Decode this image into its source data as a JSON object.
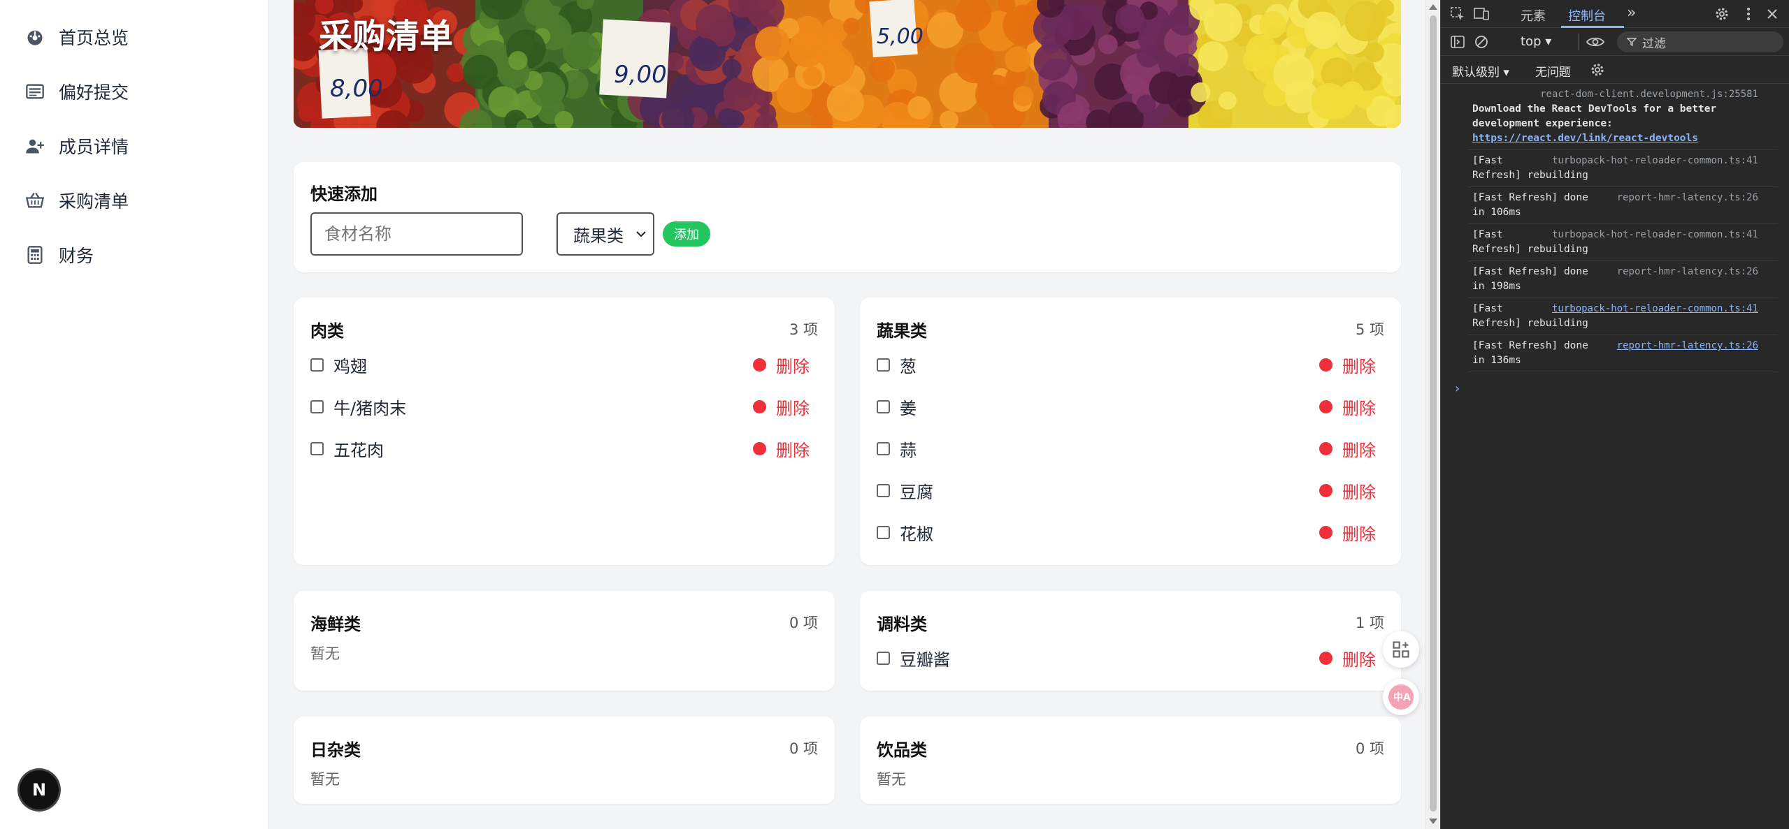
{
  "sidebar": {
    "items": [
      {
        "label": "首页总览",
        "icon": "dashboard-icon"
      },
      {
        "label": "偏好提交",
        "icon": "list-icon"
      },
      {
        "label": "成员详情",
        "icon": "user-add-icon"
      },
      {
        "label": "采购清单",
        "icon": "basket-icon"
      },
      {
        "label": "财务",
        "icon": "calculator-icon"
      }
    ],
    "badge": "N"
  },
  "hero": {
    "title": "采购清单"
  },
  "quick_add": {
    "title": "快速添加",
    "placeholder": "食材名称",
    "selected_category": "蔬果类",
    "add_label": "添加"
  },
  "categories": [
    {
      "name": "肉类",
      "count": "3 项",
      "items": [
        "鸡翅",
        "牛/猪肉末",
        "五花肉"
      ]
    },
    {
      "name": "蔬果类",
      "count": "5 项",
      "items": [
        "葱",
        "姜",
        "蒜",
        "豆腐",
        "花椒"
      ]
    },
    {
      "name": "海鲜类",
      "count": "0 项",
      "empty": "暂无"
    },
    {
      "name": "调料类",
      "count": "1 项",
      "items": [
        "豆瓣酱"
      ]
    },
    {
      "name": "日杂类",
      "count": "0 项",
      "empty": "暂无"
    },
    {
      "name": "饮品类",
      "count": "0 项",
      "empty": "暂无"
    }
  ],
  "delete_label": "删除",
  "devtools": {
    "tabs": {
      "elements": "元素",
      "console": "控制台"
    },
    "context": "top",
    "filter": "过滤",
    "level": "默认级别",
    "issues": "无问题",
    "console": [
      {
        "src": "react-dom-client.development.js:25581",
        "lines": [
          "Download the React DevTools for a better",
          "development experience:"
        ],
        "link": "https://react.dev/link/react-devtools"
      },
      {
        "src": "turbopack-hot-reloader-common.ts:41",
        "lines": [
          "[Fast",
          "Refresh] rebuilding"
        ]
      },
      {
        "src": "report-hmr-latency.ts:26",
        "lines": [
          "[Fast Refresh] done",
          "in 106ms"
        ]
      },
      {
        "src": "turbopack-hot-reloader-common.ts:41",
        "lines": [
          "[Fast",
          "Refresh] rebuilding"
        ]
      },
      {
        "src": "report-hmr-latency.ts:26",
        "lines": [
          "[Fast Refresh] done",
          "in 198ms"
        ]
      },
      {
        "src": "turbopack-hot-reloader-common.ts:41",
        "lines": [
          "[Fast",
          "Refresh] rebuilding"
        ]
      },
      {
        "src": "report-hmr-latency.ts:26",
        "lines": [
          "[Fast Refresh] done",
          "in 136ms"
        ]
      }
    ]
  }
}
